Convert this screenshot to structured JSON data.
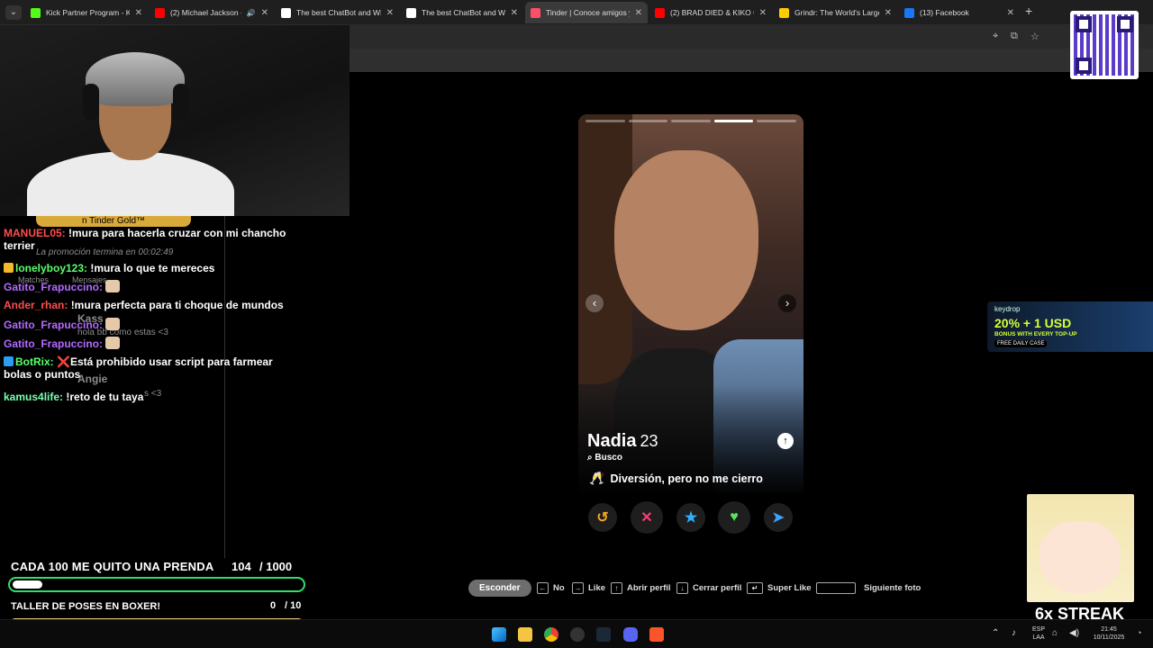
{
  "browser": {
    "tabs": [
      {
        "title": "Kick Partner Program - Ki",
        "color": "#53fc18",
        "active": false,
        "audio": false
      },
      {
        "title": "(2) Michael Jackson - ",
        "color": "#ff0000",
        "active": false,
        "audio": true
      },
      {
        "title": "The best ChatBot and Wi",
        "color": "#ffffff",
        "active": false,
        "audio": false
      },
      {
        "title": "The best ChatBot and Wi",
        "color": "#ffffff",
        "active": false,
        "audio": false
      },
      {
        "title": "Tinder | Conoce amigos y",
        "color": "#fd5068",
        "active": true,
        "audio": false
      },
      {
        "title": "(2) BRAD DIED & KIKO Cr",
        "color": "#ff0000",
        "active": false,
        "audio": false
      },
      {
        "title": "Grindr: The World's Large",
        "color": "#ffcc00",
        "active": false,
        "audio": false
      },
      {
        "title": "(13) Facebook",
        "color": "#1877f2",
        "active": false,
        "audio": false
      }
    ],
    "new_tab": "+"
  },
  "overlay_ghost": {
    "gold": "Gold ™",
    "tinder_gold": "n Tinder Gold™",
    "promo": "La promoción termina en 00:02:49",
    "matches": "Matches",
    "mensajes": "Mensajes",
    "kass": "Kass",
    "kass_msg": "hola bb como estas <3",
    "angie": "Angie",
    "angie_msg": "s <3"
  },
  "chat": {
    "messages": [
      {
        "user": "MANUEL05:",
        "color": "#ff4d4d",
        "text": "!mura para hacerla cruzar con mi chancho terrier"
      },
      {
        "user": "lonelyboy123:",
        "color": "#5bff6b",
        "text": "!mura lo que te mereces",
        "badge": "#f5b82a"
      },
      {
        "user": "Gatito_Frapuccino:",
        "color": "#b36bff",
        "text": "",
        "emote": true
      },
      {
        "user": "Ander_rhan:",
        "color": "#ff4d4d",
        "text": "!mura perfecta para ti choque de mundos"
      },
      {
        "user": "Gatito_Frapuccino:",
        "color": "#b36bff",
        "text": "",
        "emote": true
      },
      {
        "user": "Gatito_Frapuccino:",
        "color": "#b36bff",
        "text": "",
        "emote": true
      },
      {
        "user": "BotRix:",
        "color": "#5bff6b",
        "text": "Está prohibido usar script para farmear bolas o puntos",
        "badge": "#2a9df4",
        "cross": "❌"
      },
      {
        "user": "kamus4life:",
        "color": "#7cffb0",
        "text": "!reto de tu taya"
      }
    ]
  },
  "goals": {
    "goal1": {
      "title": "CADA 100 ME QUITO UNA PRENDA",
      "current": "104",
      "total": "/ 1000",
      "progress": 0.104
    },
    "goal2": {
      "title": "TALLER DE POSES EN BOXER!",
      "current": "0",
      "total": "/ 10",
      "progress": 0
    }
  },
  "profile": {
    "name": "Nadia",
    "age": "23",
    "looking_for_label": "Busco",
    "intent": "Diversión, pero no me cierro",
    "photo_count": 5,
    "active_photo": 4,
    "prev_icon": "‹",
    "next_icon": "›",
    "info_icon": "↑"
  },
  "actions": {
    "rewind_icon": "↺",
    "nope_icon": "✕",
    "superlike_icon": "★",
    "like_icon": "♥",
    "boost_icon": "➤"
  },
  "hints": {
    "hide": "Esconder",
    "no": "No",
    "like": "Like",
    "open_profile": "Abrir perfil",
    "close_profile": "Cerrar perfil",
    "super_like": "Super Like",
    "next_photo": "Siguiente foto"
  },
  "keydrop": {
    "logo": "keydrop",
    "headline": "20% + 1 USD",
    "sub": "BONUS WITH EVERY TOP-UP",
    "tag": "FREE DAILY CASE"
  },
  "streak": "6x STREAK",
  "taskbar": {
    "lang": "ESP",
    "region": "LAA",
    "time": "21:45",
    "date": "10/11/2025"
  }
}
